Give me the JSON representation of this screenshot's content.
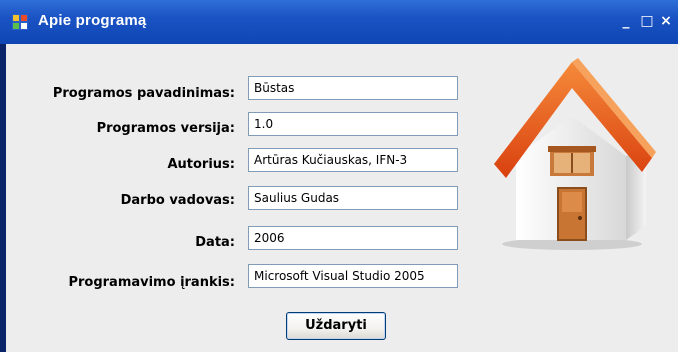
{
  "window": {
    "title": "Apie programą",
    "controls": {
      "minimize": "_",
      "maximize": "□",
      "close": "×"
    }
  },
  "fields": [
    {
      "label": "Programos pavadinimas:",
      "value": "Būstas"
    },
    {
      "label": "Programos versija:",
      "value": "1.0"
    },
    {
      "label": "Autorius:",
      "value": "Artūras Kučiauskas, IFN-3"
    },
    {
      "label": "Darbo vadovas:",
      "value": "Saulius Gudas"
    },
    {
      "label": "Data:",
      "value": "2006"
    },
    {
      "label": "Programavimo įrankis:",
      "value": "Microsoft Visual Studio 2005"
    }
  ],
  "buttons": {
    "close_label": "Uždaryti"
  },
  "icons": {
    "app": "app-window-icon",
    "illustration": "house-icon"
  },
  "colors": {
    "titlebar": "#1b53c4",
    "client_bg": "#eeeded",
    "roof": "#e8571c",
    "door": "#c87533"
  }
}
